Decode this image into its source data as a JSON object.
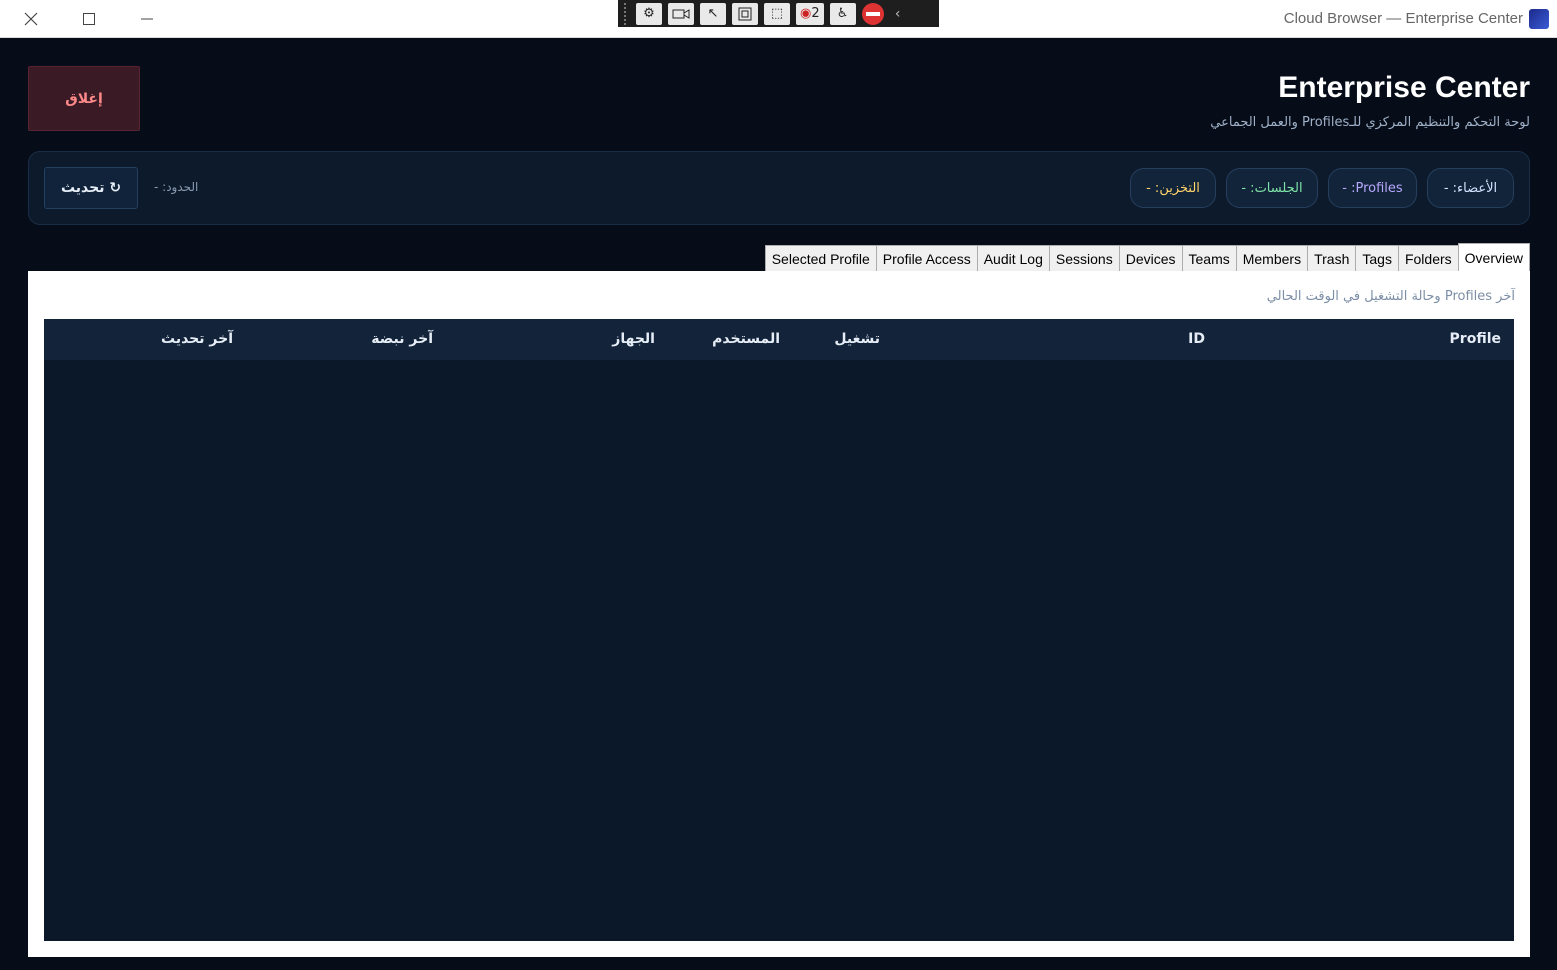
{
  "window": {
    "title": "Cloud Browser — Enterprise Center",
    "recorder_count": "2"
  },
  "header": {
    "title": "Enterprise Center",
    "subtitle": "لوحة التحكم والتنظيم المركزي للـProfiles والعمل الجماعي",
    "close_label": "إغلاق"
  },
  "stats": {
    "members": "الأعضاء: -",
    "profiles": "Profiles: -",
    "sessions": "الجلسات: -",
    "storage": "التخزين: -",
    "limits": "الحدود: -",
    "refresh_label": "↻ تحديث",
    "colors": {
      "members": "#cfe3ff",
      "profiles": "#b7a8ff",
      "sessions": "#7ee3a6",
      "storage": "#ffd36b"
    }
  },
  "tabs": [
    "Overview",
    "Folders",
    "Tags",
    "Trash",
    "Members",
    "Teams",
    "Devices",
    "Sessions",
    "Audit Log",
    "Profile Access",
    "Selected Profile"
  ],
  "active_tab": "Overview",
  "overview": {
    "description": "آخر Profiles وحالة التشغيل في الوقت الحالي",
    "columns": {
      "profile": "Profile",
      "id": "ID",
      "running": "تشغيل",
      "user": "المستخدم",
      "device": "الجهاز",
      "heartbeat": "آخر نبضة",
      "updated": "آخر تحديث"
    },
    "rows": []
  }
}
